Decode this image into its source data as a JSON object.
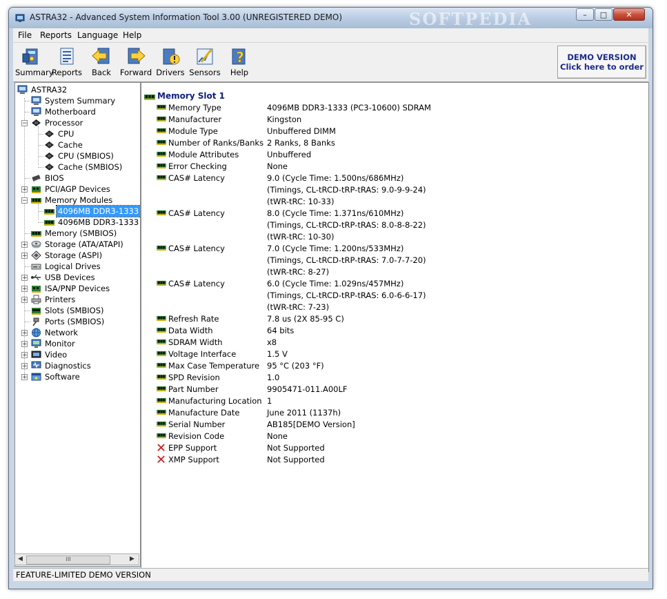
{
  "window": {
    "title": "ASTRA32 - Advanced System Information Tool 3.00 (UNREGISTERED DEMO)",
    "watermark": "SOFTPEDIA",
    "controls": {
      "minimize": "–",
      "maximize": "□",
      "close": "✕"
    }
  },
  "menu": [
    "File",
    "Reports",
    "Language",
    "Help"
  ],
  "toolbar": {
    "buttons": [
      {
        "label": "Summary",
        "icon": "summary-icon"
      },
      {
        "label": "Reports",
        "icon": "reports-icon"
      },
      {
        "label": "Back",
        "icon": "back-arrow-icon"
      },
      {
        "label": "Forward",
        "icon": "forward-arrow-icon"
      },
      {
        "label": "Drivers",
        "icon": "drivers-icon"
      },
      {
        "label": "Sensors",
        "icon": "sensors-icon"
      },
      {
        "label": "Help",
        "icon": "help-icon"
      }
    ],
    "demo_line1": "DEMO VERSION",
    "demo_line2": "Click here to order"
  },
  "tree": {
    "root": "ASTRA32",
    "items": [
      {
        "label": "System Summary",
        "icon": "computer-icon"
      },
      {
        "label": "Motherboard",
        "icon": "computer-icon"
      },
      {
        "label": "Processor",
        "icon": "chip-icon"
      },
      {
        "label": "CPU",
        "icon": "chip-icon"
      },
      {
        "label": "Cache",
        "icon": "chip-icon"
      },
      {
        "label": "CPU (SMBIOS)",
        "icon": "chip-icon"
      },
      {
        "label": "Cache (SMBIOS)",
        "icon": "chip-icon"
      },
      {
        "label": "BIOS",
        "icon": "bios-chip-icon"
      },
      {
        "label": "PCI/AGP Devices",
        "icon": "card-icon"
      },
      {
        "label": "Memory Modules",
        "icon": "memory-icon"
      },
      {
        "label": "4096MB DDR3-1333 (P",
        "icon": "memory-icon"
      },
      {
        "label": "4096MB DDR3-1333 (P",
        "icon": "memory-icon"
      },
      {
        "label": "Memory (SMBIOS)",
        "icon": "memory-icon"
      },
      {
        "label": "Storage (ATA/ATAPI)",
        "icon": "disk-icon"
      },
      {
        "label": "Storage (ASPI)",
        "icon": "diamond-icon"
      },
      {
        "label": "Logical Drives",
        "icon": "drive-icon"
      },
      {
        "label": "USB Devices",
        "icon": "usb-icon"
      },
      {
        "label": "ISA/PNP Devices",
        "icon": "card-icon"
      },
      {
        "label": "Printers",
        "icon": "printer-icon"
      },
      {
        "label": "Slots (SMBIOS)",
        "icon": "slot-icon"
      },
      {
        "label": "Ports (SMBIOS)",
        "icon": "port-icon"
      },
      {
        "label": "Network",
        "icon": "network-icon"
      },
      {
        "label": "Monitor",
        "icon": "monitor-icon"
      },
      {
        "label": "Video",
        "icon": "video-icon"
      },
      {
        "label": "Diagnostics",
        "icon": "diagnostics-icon"
      },
      {
        "label": "Software",
        "icon": "software-icon"
      }
    ]
  },
  "scrollbar": {
    "left": "◀",
    "right": "▶",
    "grip": "III"
  },
  "detail": {
    "title": "Memory Slot 1",
    "rows": [
      {
        "label": "Memory Type",
        "value": "4096MB DDR3-1333 (PC3-10600) SDRAM",
        "icon": "memory-icon"
      },
      {
        "label": "Manufacturer",
        "value": "Kingston",
        "icon": "memory-icon"
      },
      {
        "label": "Module Type",
        "value": "Unbuffered DIMM",
        "icon": "memory-icon"
      },
      {
        "label": "Number of Ranks/Banks",
        "value": "2 Ranks, 8 Banks",
        "icon": "memory-icon"
      },
      {
        "label": "Module Attributes",
        "value": "Unbuffered",
        "icon": "memory-icon"
      },
      {
        "label": "Error Checking",
        "value": "None",
        "icon": "memory-icon"
      },
      {
        "label": "CAS# Latency",
        "value": "9.0 (Cycle Time: 1.500ns/686MHz)",
        "icon": "memory-icon"
      },
      {
        "label": "",
        "value": "(Timings, CL-tRCD-tRP-tRAS: 9.0-9-9-24)",
        "icon": ""
      },
      {
        "label": "",
        "value": "(tWR-tRC: 10-33)",
        "icon": ""
      },
      {
        "label": "CAS# Latency",
        "value": "8.0 (Cycle Time: 1.371ns/610MHz)",
        "icon": "memory-icon"
      },
      {
        "label": "",
        "value": "(Timings, CL-tRCD-tRP-tRAS: 8.0-8-8-22)",
        "icon": ""
      },
      {
        "label": "",
        "value": "(tWR-tRC: 10-30)",
        "icon": ""
      },
      {
        "label": "CAS# Latency",
        "value": "7.0 (Cycle Time: 1.200ns/533MHz)",
        "icon": "memory-icon"
      },
      {
        "label": "",
        "value": "(Timings, CL-tRCD-tRP-tRAS: 7.0-7-7-20)",
        "icon": ""
      },
      {
        "label": "",
        "value": "(tWR-tRC: 8-27)",
        "icon": ""
      },
      {
        "label": "CAS# Latency",
        "value": "6.0 (Cycle Time: 1.029ns/457MHz)",
        "icon": "memory-icon"
      },
      {
        "label": "",
        "value": "(Timings, CL-tRCD-tRP-tRAS: 6.0-6-6-17)",
        "icon": ""
      },
      {
        "label": "",
        "value": "(tWR-tRC: 7-23)",
        "icon": ""
      },
      {
        "label": "Refresh Rate",
        "value": "7.8 us (2X 85-95 C)",
        "icon": "memory-icon"
      },
      {
        "label": "Data Width",
        "value": "64 bits",
        "icon": "memory-icon"
      },
      {
        "label": "SDRAM Width",
        "value": "x8",
        "icon": "memory-icon"
      },
      {
        "label": "Voltage Interface",
        "value": "1.5 V",
        "icon": "memory-icon"
      },
      {
        "label": "Max Case Temperature",
        "value": "95 °C (203 °F)",
        "icon": "memory-icon"
      },
      {
        "label": "SPD Revision",
        "value": "1.0",
        "icon": "memory-icon"
      },
      {
        "label": "Part Number",
        "value": "9905471-011.A00LF",
        "icon": "memory-icon"
      },
      {
        "label": "Manufacturing Location",
        "value": "1",
        "icon": "memory-icon"
      },
      {
        "label": "Manufacture Date",
        "value": "June 2011 (1137h)",
        "icon": "memory-icon"
      },
      {
        "label": "Serial Number",
        "value": "AB185[DEMO Version]",
        "icon": "memory-icon"
      },
      {
        "label": "Revision Code",
        "value": "None",
        "icon": "memory-icon"
      },
      {
        "label": "EPP Support",
        "value": "Not Supported",
        "icon": "cross-icon"
      },
      {
        "label": "XMP Support",
        "value": "Not Supported",
        "icon": "cross-icon"
      }
    ]
  },
  "status": "FEATURE-LIMITED DEMO VERSION",
  "colors": {
    "accent": "#102080",
    "selection": "#3399ff",
    "cross": "#d02020",
    "memory_chip": "#2e7d32"
  }
}
